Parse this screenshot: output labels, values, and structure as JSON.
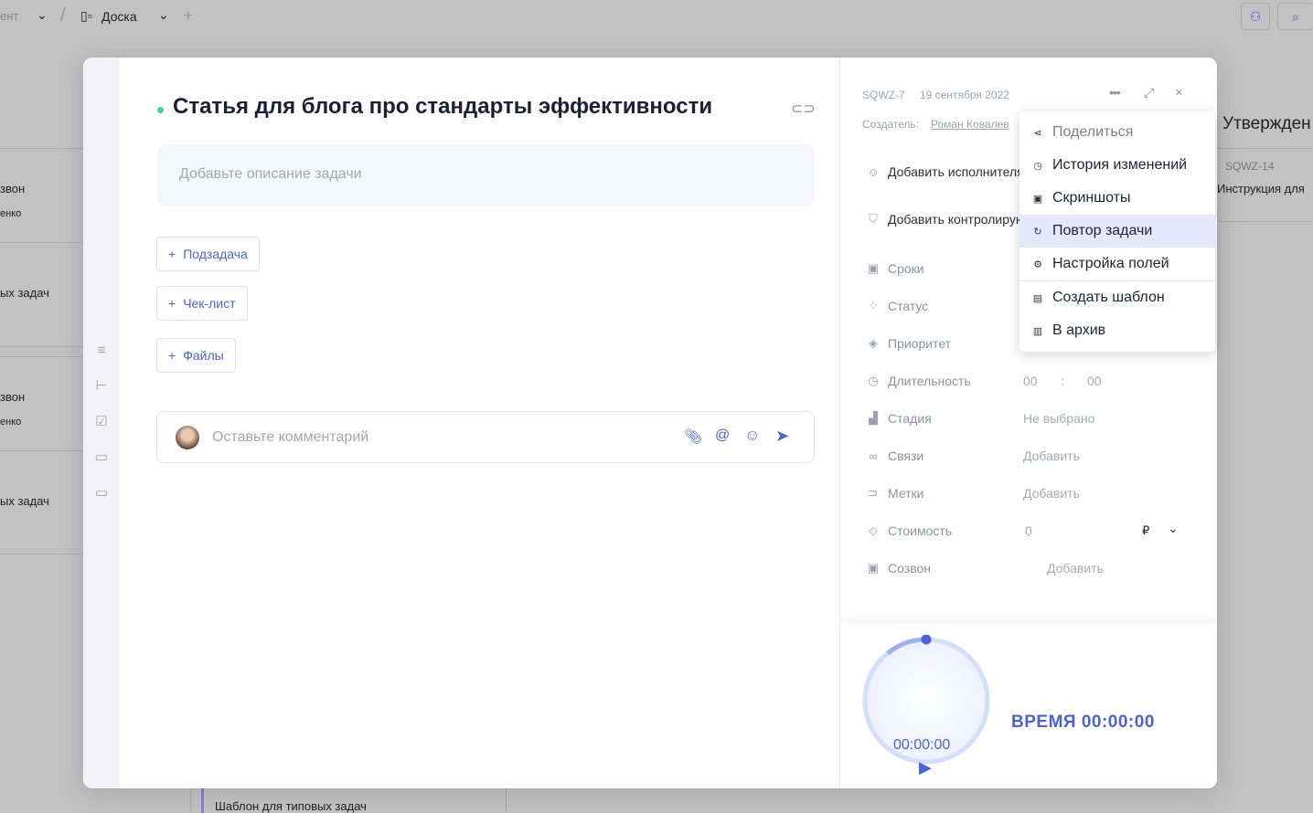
{
  "topbar": {
    "crumb1": "ент",
    "crumb2": "Доска",
    "add": "+"
  },
  "background": {
    "column_title": "Утвержден",
    "card_id": "SQWZ-14",
    "card_title": "Инструкция для",
    "left_texts": [
      "звон",
      "енко",
      "ых задач",
      "звон",
      "енко",
      "ых задач"
    ],
    "bottom_card": "Шаблон для типовых задач"
  },
  "task": {
    "title": "Статья для блога про стандарты эффективности",
    "description_placeholder": "Добавьте описание задачи",
    "buttons": [
      "Подзадача",
      "Чек-лист",
      "Файлы"
    ],
    "comment_placeholder": "Оставьте комментарий"
  },
  "panel": {
    "id": "SQWZ-7",
    "date": "19 сентября 2022",
    "creator_label": "Создатель:",
    "creator": "Роман Ковалев",
    "add_assignee": "Добавить исполнителя",
    "add_controller": "Добавить контролирующего",
    "fields": [
      {
        "label": "Сроки",
        "value": ""
      },
      {
        "label": "Статус",
        "value": ""
      },
      {
        "label": "Приоритет",
        "value": ""
      },
      {
        "label": "Длительность",
        "value": "00"
      },
      {
        "label": "Стадия",
        "value": "Не выбрано"
      },
      {
        "label": "Связи",
        "value": "Добавить"
      },
      {
        "label": "Метки",
        "value": "Добавить"
      },
      {
        "label": "Стоимость",
        "value": "0"
      },
      {
        "label": "Созвон",
        "value": "Добавить"
      }
    ],
    "duration_minutes": "00",
    "duration_sep": ":",
    "currency": "₽"
  },
  "timer": {
    "display": "00:00:00",
    "label": "ВРЕМЯ 00:00:00"
  },
  "menu": {
    "items": [
      "Поделиться",
      "История изменений",
      "Скриншоты",
      "Повтор задачи",
      "Настройка полей",
      "Создать шаблон",
      "В архив"
    ]
  },
  "colors": {
    "accent": "#4a63d8",
    "status_dot": "#3ecfa6",
    "menu_active": "#e4e8fb"
  }
}
